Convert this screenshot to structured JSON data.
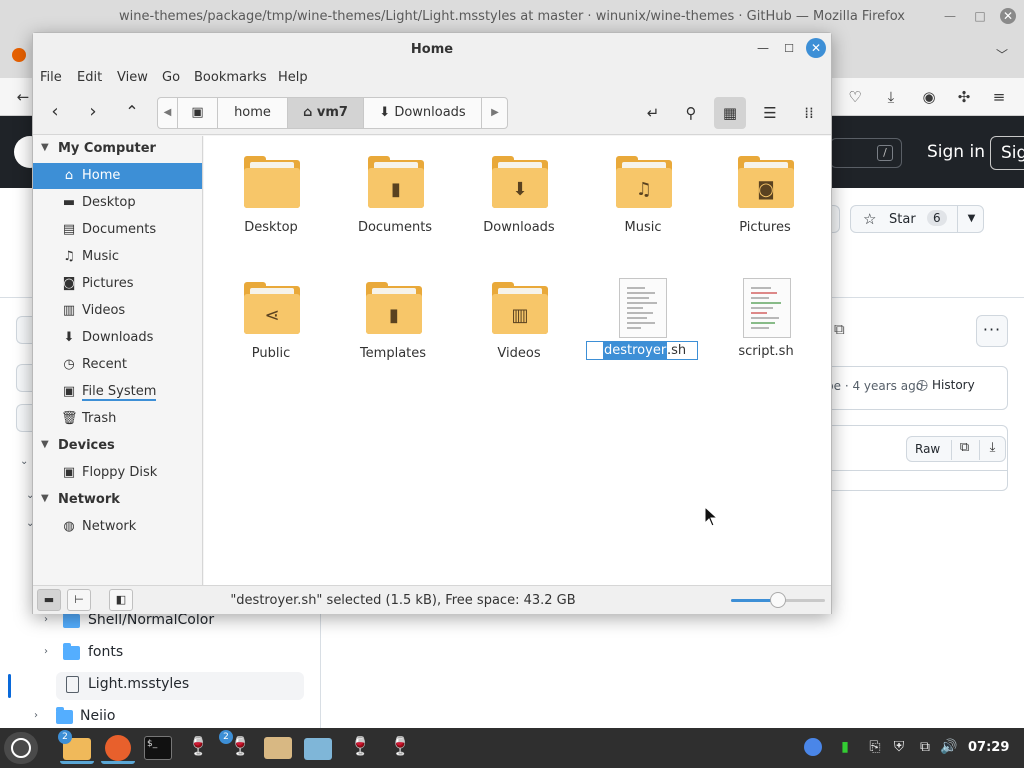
{
  "firefox": {
    "title": "wine-themes/package/tmp/wine-themes/Light/Light.msstyles at master · winunix/wine-themes · GitHub — Mozilla Firefox",
    "github": {
      "search_key": "/",
      "sign_in": "Sign in",
      "sign_up": "Sig",
      "star_label": "Star",
      "star_count": "6",
      "commit_info": "pe · 4 years ago",
      "history_label": "History",
      "raw_label": "Raw",
      "tree": [
        {
          "label": "Shell/NormalColor",
          "type": "folder"
        },
        {
          "label": "fonts",
          "type": "folder"
        },
        {
          "label": "Light.msstyles",
          "type": "file"
        },
        {
          "label": "Neiio",
          "type": "folder"
        }
      ]
    }
  },
  "nemo": {
    "title": "Home",
    "menu": [
      "File",
      "Edit",
      "View",
      "Go",
      "Bookmarks",
      "Help"
    ],
    "breadcrumbs": [
      {
        "label": "home",
        "icon": "",
        "active": false
      },
      {
        "label": "vm7",
        "icon": "home-icon",
        "active": true
      },
      {
        "label": "Downloads",
        "icon": "download-icon",
        "active": false
      }
    ],
    "sidebar": {
      "sections": [
        {
          "title": "My Computer",
          "items": [
            {
              "label": "Home",
              "icon": "home-icon",
              "active": true
            },
            {
              "label": "Desktop",
              "icon": "desktop-icon",
              "active": false
            },
            {
              "label": "Documents",
              "icon": "document-icon",
              "active": false
            },
            {
              "label": "Music",
              "icon": "music-icon",
              "active": false
            },
            {
              "label": "Pictures",
              "icon": "camera-icon",
              "active": false
            },
            {
              "label": "Videos",
              "icon": "film-icon",
              "active": false
            },
            {
              "label": "Downloads",
              "icon": "download-icon",
              "active": false
            },
            {
              "label": "Recent",
              "icon": "clock-icon",
              "active": false
            },
            {
              "label": "File System",
              "icon": "drive-icon",
              "active": false
            },
            {
              "label": "Trash",
              "icon": "trash-icon",
              "active": false
            }
          ]
        },
        {
          "title": "Devices",
          "items": [
            {
              "label": "Floppy Disk",
              "icon": "floppy-icon",
              "active": false
            }
          ]
        },
        {
          "title": "Network",
          "items": [
            {
              "label": "Network",
              "icon": "globe-icon",
              "active": false
            }
          ]
        }
      ]
    },
    "files": [
      {
        "label": "Desktop",
        "type": "folder",
        "emblem": ""
      },
      {
        "label": "Documents",
        "type": "folder",
        "emblem": "document-icon"
      },
      {
        "label": "Downloads",
        "type": "folder",
        "emblem": "download-icon"
      },
      {
        "label": "Music",
        "type": "folder",
        "emblem": "music-icon"
      },
      {
        "label": "Pictures",
        "type": "folder",
        "emblem": "camera-icon"
      },
      {
        "label": "Public",
        "type": "folder",
        "emblem": "share-icon"
      },
      {
        "label": "Templates",
        "type": "folder",
        "emblem": "template-icon"
      },
      {
        "label": "Videos",
        "type": "folder",
        "emblem": "film-icon"
      },
      {
        "label": "destroyer.sh",
        "type": "script",
        "renaming": true
      },
      {
        "label": "script.sh",
        "type": "script",
        "renaming": false
      }
    ],
    "rename": {
      "selected": "destroyer",
      "rest": ".sh"
    },
    "status": "\"destroyer.sh\" selected (1.5 kB), Free space: 43.2 GB",
    "zoom_level": 0.5
  },
  "taskbar": {
    "clock": "07:29",
    "badges": {
      "files": "2",
      "wine": "2"
    }
  },
  "colors": {
    "accent": "#3d8fd6",
    "folder": "#f7c669",
    "github_header": "#1f2328"
  }
}
